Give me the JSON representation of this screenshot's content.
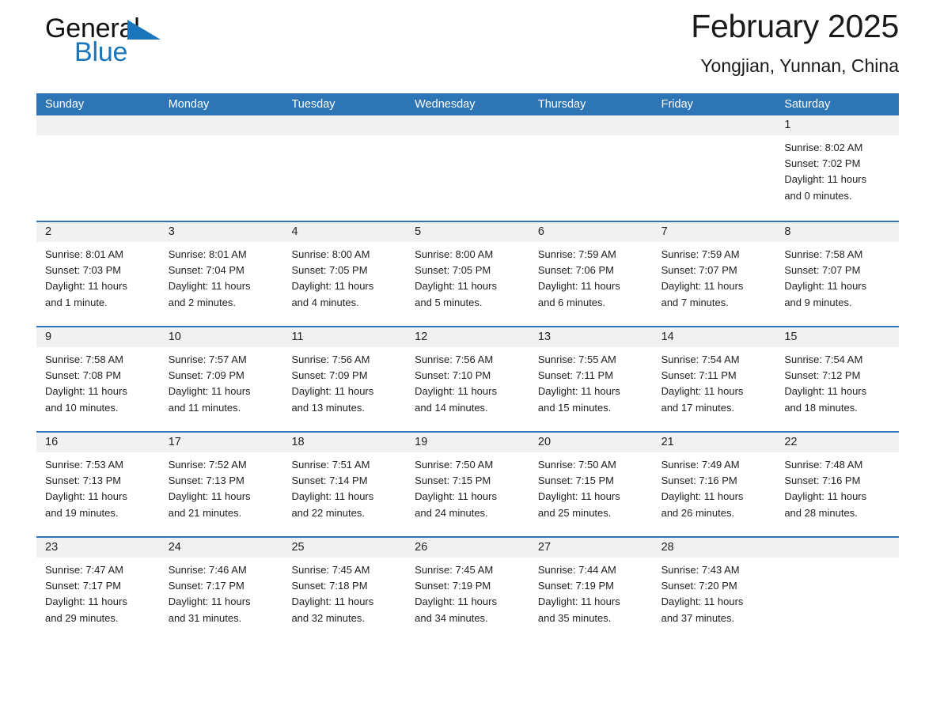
{
  "brand": {
    "word1": "General",
    "word2": "Blue",
    "flag_color": "#1a75bb"
  },
  "header": {
    "month_title": "February 2025",
    "location": "Yongjian, Yunnan, China"
  },
  "theme": {
    "header_blue": "#2e75b6",
    "day_band_gray": "#f1f1f1",
    "text": "#222222"
  },
  "calendar": {
    "weekdays": [
      "Sunday",
      "Monday",
      "Tuesday",
      "Wednesday",
      "Thursday",
      "Friday",
      "Saturday"
    ],
    "weeks": [
      [
        {
          "day": "",
          "lines": []
        },
        {
          "day": "",
          "lines": []
        },
        {
          "day": "",
          "lines": []
        },
        {
          "day": "",
          "lines": []
        },
        {
          "day": "",
          "lines": []
        },
        {
          "day": "",
          "lines": []
        },
        {
          "day": "1",
          "lines": [
            "Sunrise: 8:02 AM",
            "Sunset: 7:02 PM",
            "Daylight: 11 hours",
            "and 0 minutes."
          ]
        }
      ],
      [
        {
          "day": "2",
          "lines": [
            "Sunrise: 8:01 AM",
            "Sunset: 7:03 PM",
            "Daylight: 11 hours",
            "and 1 minute."
          ]
        },
        {
          "day": "3",
          "lines": [
            "Sunrise: 8:01 AM",
            "Sunset: 7:04 PM",
            "Daylight: 11 hours",
            "and 2 minutes."
          ]
        },
        {
          "day": "4",
          "lines": [
            "Sunrise: 8:00 AM",
            "Sunset: 7:05 PM",
            "Daylight: 11 hours",
            "and 4 minutes."
          ]
        },
        {
          "day": "5",
          "lines": [
            "Sunrise: 8:00 AM",
            "Sunset: 7:05 PM",
            "Daylight: 11 hours",
            "and 5 minutes."
          ]
        },
        {
          "day": "6",
          "lines": [
            "Sunrise: 7:59 AM",
            "Sunset: 7:06 PM",
            "Daylight: 11 hours",
            "and 6 minutes."
          ]
        },
        {
          "day": "7",
          "lines": [
            "Sunrise: 7:59 AM",
            "Sunset: 7:07 PM",
            "Daylight: 11 hours",
            "and 7 minutes."
          ]
        },
        {
          "day": "8",
          "lines": [
            "Sunrise: 7:58 AM",
            "Sunset: 7:07 PM",
            "Daylight: 11 hours",
            "and 9 minutes."
          ]
        }
      ],
      [
        {
          "day": "9",
          "lines": [
            "Sunrise: 7:58 AM",
            "Sunset: 7:08 PM",
            "Daylight: 11 hours",
            "and 10 minutes."
          ]
        },
        {
          "day": "10",
          "lines": [
            "Sunrise: 7:57 AM",
            "Sunset: 7:09 PM",
            "Daylight: 11 hours",
            "and 11 minutes."
          ]
        },
        {
          "day": "11",
          "lines": [
            "Sunrise: 7:56 AM",
            "Sunset: 7:09 PM",
            "Daylight: 11 hours",
            "and 13 minutes."
          ]
        },
        {
          "day": "12",
          "lines": [
            "Sunrise: 7:56 AM",
            "Sunset: 7:10 PM",
            "Daylight: 11 hours",
            "and 14 minutes."
          ]
        },
        {
          "day": "13",
          "lines": [
            "Sunrise: 7:55 AM",
            "Sunset: 7:11 PM",
            "Daylight: 11 hours",
            "and 15 minutes."
          ]
        },
        {
          "day": "14",
          "lines": [
            "Sunrise: 7:54 AM",
            "Sunset: 7:11 PM",
            "Daylight: 11 hours",
            "and 17 minutes."
          ]
        },
        {
          "day": "15",
          "lines": [
            "Sunrise: 7:54 AM",
            "Sunset: 7:12 PM",
            "Daylight: 11 hours",
            "and 18 minutes."
          ]
        }
      ],
      [
        {
          "day": "16",
          "lines": [
            "Sunrise: 7:53 AM",
            "Sunset: 7:13 PM",
            "Daylight: 11 hours",
            "and 19 minutes."
          ]
        },
        {
          "day": "17",
          "lines": [
            "Sunrise: 7:52 AM",
            "Sunset: 7:13 PM",
            "Daylight: 11 hours",
            "and 21 minutes."
          ]
        },
        {
          "day": "18",
          "lines": [
            "Sunrise: 7:51 AM",
            "Sunset: 7:14 PM",
            "Daylight: 11 hours",
            "and 22 minutes."
          ]
        },
        {
          "day": "19",
          "lines": [
            "Sunrise: 7:50 AM",
            "Sunset: 7:15 PM",
            "Daylight: 11 hours",
            "and 24 minutes."
          ]
        },
        {
          "day": "20",
          "lines": [
            "Sunrise: 7:50 AM",
            "Sunset: 7:15 PM",
            "Daylight: 11 hours",
            "and 25 minutes."
          ]
        },
        {
          "day": "21",
          "lines": [
            "Sunrise: 7:49 AM",
            "Sunset: 7:16 PM",
            "Daylight: 11 hours",
            "and 26 minutes."
          ]
        },
        {
          "day": "22",
          "lines": [
            "Sunrise: 7:48 AM",
            "Sunset: 7:16 PM",
            "Daylight: 11 hours",
            "and 28 minutes."
          ]
        }
      ],
      [
        {
          "day": "23",
          "lines": [
            "Sunrise: 7:47 AM",
            "Sunset: 7:17 PM",
            "Daylight: 11 hours",
            "and 29 minutes."
          ]
        },
        {
          "day": "24",
          "lines": [
            "Sunrise: 7:46 AM",
            "Sunset: 7:17 PM",
            "Daylight: 11 hours",
            "and 31 minutes."
          ]
        },
        {
          "day": "25",
          "lines": [
            "Sunrise: 7:45 AM",
            "Sunset: 7:18 PM",
            "Daylight: 11 hours",
            "and 32 minutes."
          ]
        },
        {
          "day": "26",
          "lines": [
            "Sunrise: 7:45 AM",
            "Sunset: 7:19 PM",
            "Daylight: 11 hours",
            "and 34 minutes."
          ]
        },
        {
          "day": "27",
          "lines": [
            "Sunrise: 7:44 AM",
            "Sunset: 7:19 PM",
            "Daylight: 11 hours",
            "and 35 minutes."
          ]
        },
        {
          "day": "28",
          "lines": [
            "Sunrise: 7:43 AM",
            "Sunset: 7:20 PM",
            "Daylight: 11 hours",
            "and 37 minutes."
          ]
        },
        {
          "day": "",
          "lines": []
        }
      ]
    ]
  }
}
